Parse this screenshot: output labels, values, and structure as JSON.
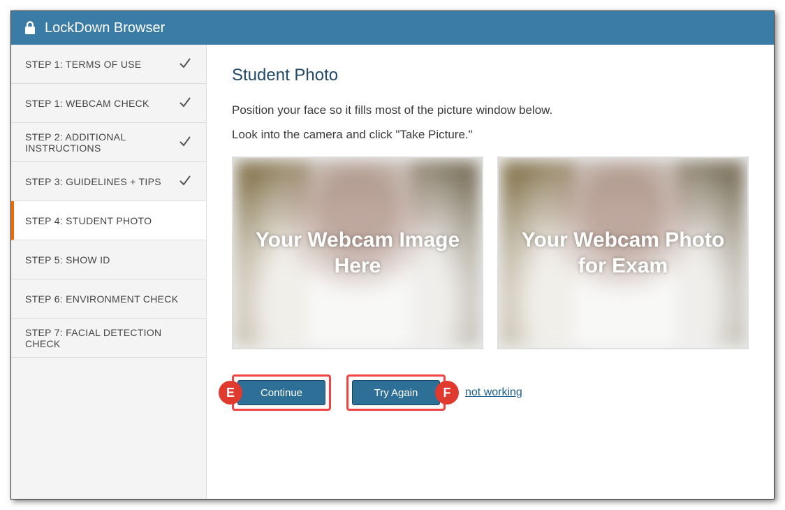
{
  "titlebar": {
    "title": "LockDown Browser"
  },
  "sidebar": {
    "steps": [
      {
        "label": "STEP 1: TERMS OF USE",
        "completed": true,
        "active": false
      },
      {
        "label": "STEP 1: WEBCAM CHECK",
        "completed": true,
        "active": false
      },
      {
        "label": "STEP 2: ADDITIONAL INSTRUCTIONS",
        "completed": true,
        "active": false
      },
      {
        "label": "STEP 3: GUIDELINES + TIPS",
        "completed": true,
        "active": false
      },
      {
        "label": "STEP 4: STUDENT PHOTO",
        "completed": false,
        "active": true
      },
      {
        "label": "STEP 5: SHOW ID",
        "completed": false,
        "active": false
      },
      {
        "label": "STEP 6: ENVIRONMENT CHECK",
        "completed": false,
        "active": false
      },
      {
        "label": "STEP 7: FACIAL DETECTION CHECK",
        "completed": false,
        "active": false
      }
    ]
  },
  "main": {
    "title": "Student Photo",
    "instruction1": "Position your face so it fills most of the picture window below.",
    "instruction2": "Look into the camera and click \"Take Picture.\"",
    "webcam_left_label": "Your Webcam Image Here",
    "webcam_right_label": "Your Webcam Photo for Exam",
    "continue_label": "Continue",
    "tryagain_label": "Try Again",
    "notworking_label": "not working",
    "callout_e": "E",
    "callout_f": "F"
  }
}
